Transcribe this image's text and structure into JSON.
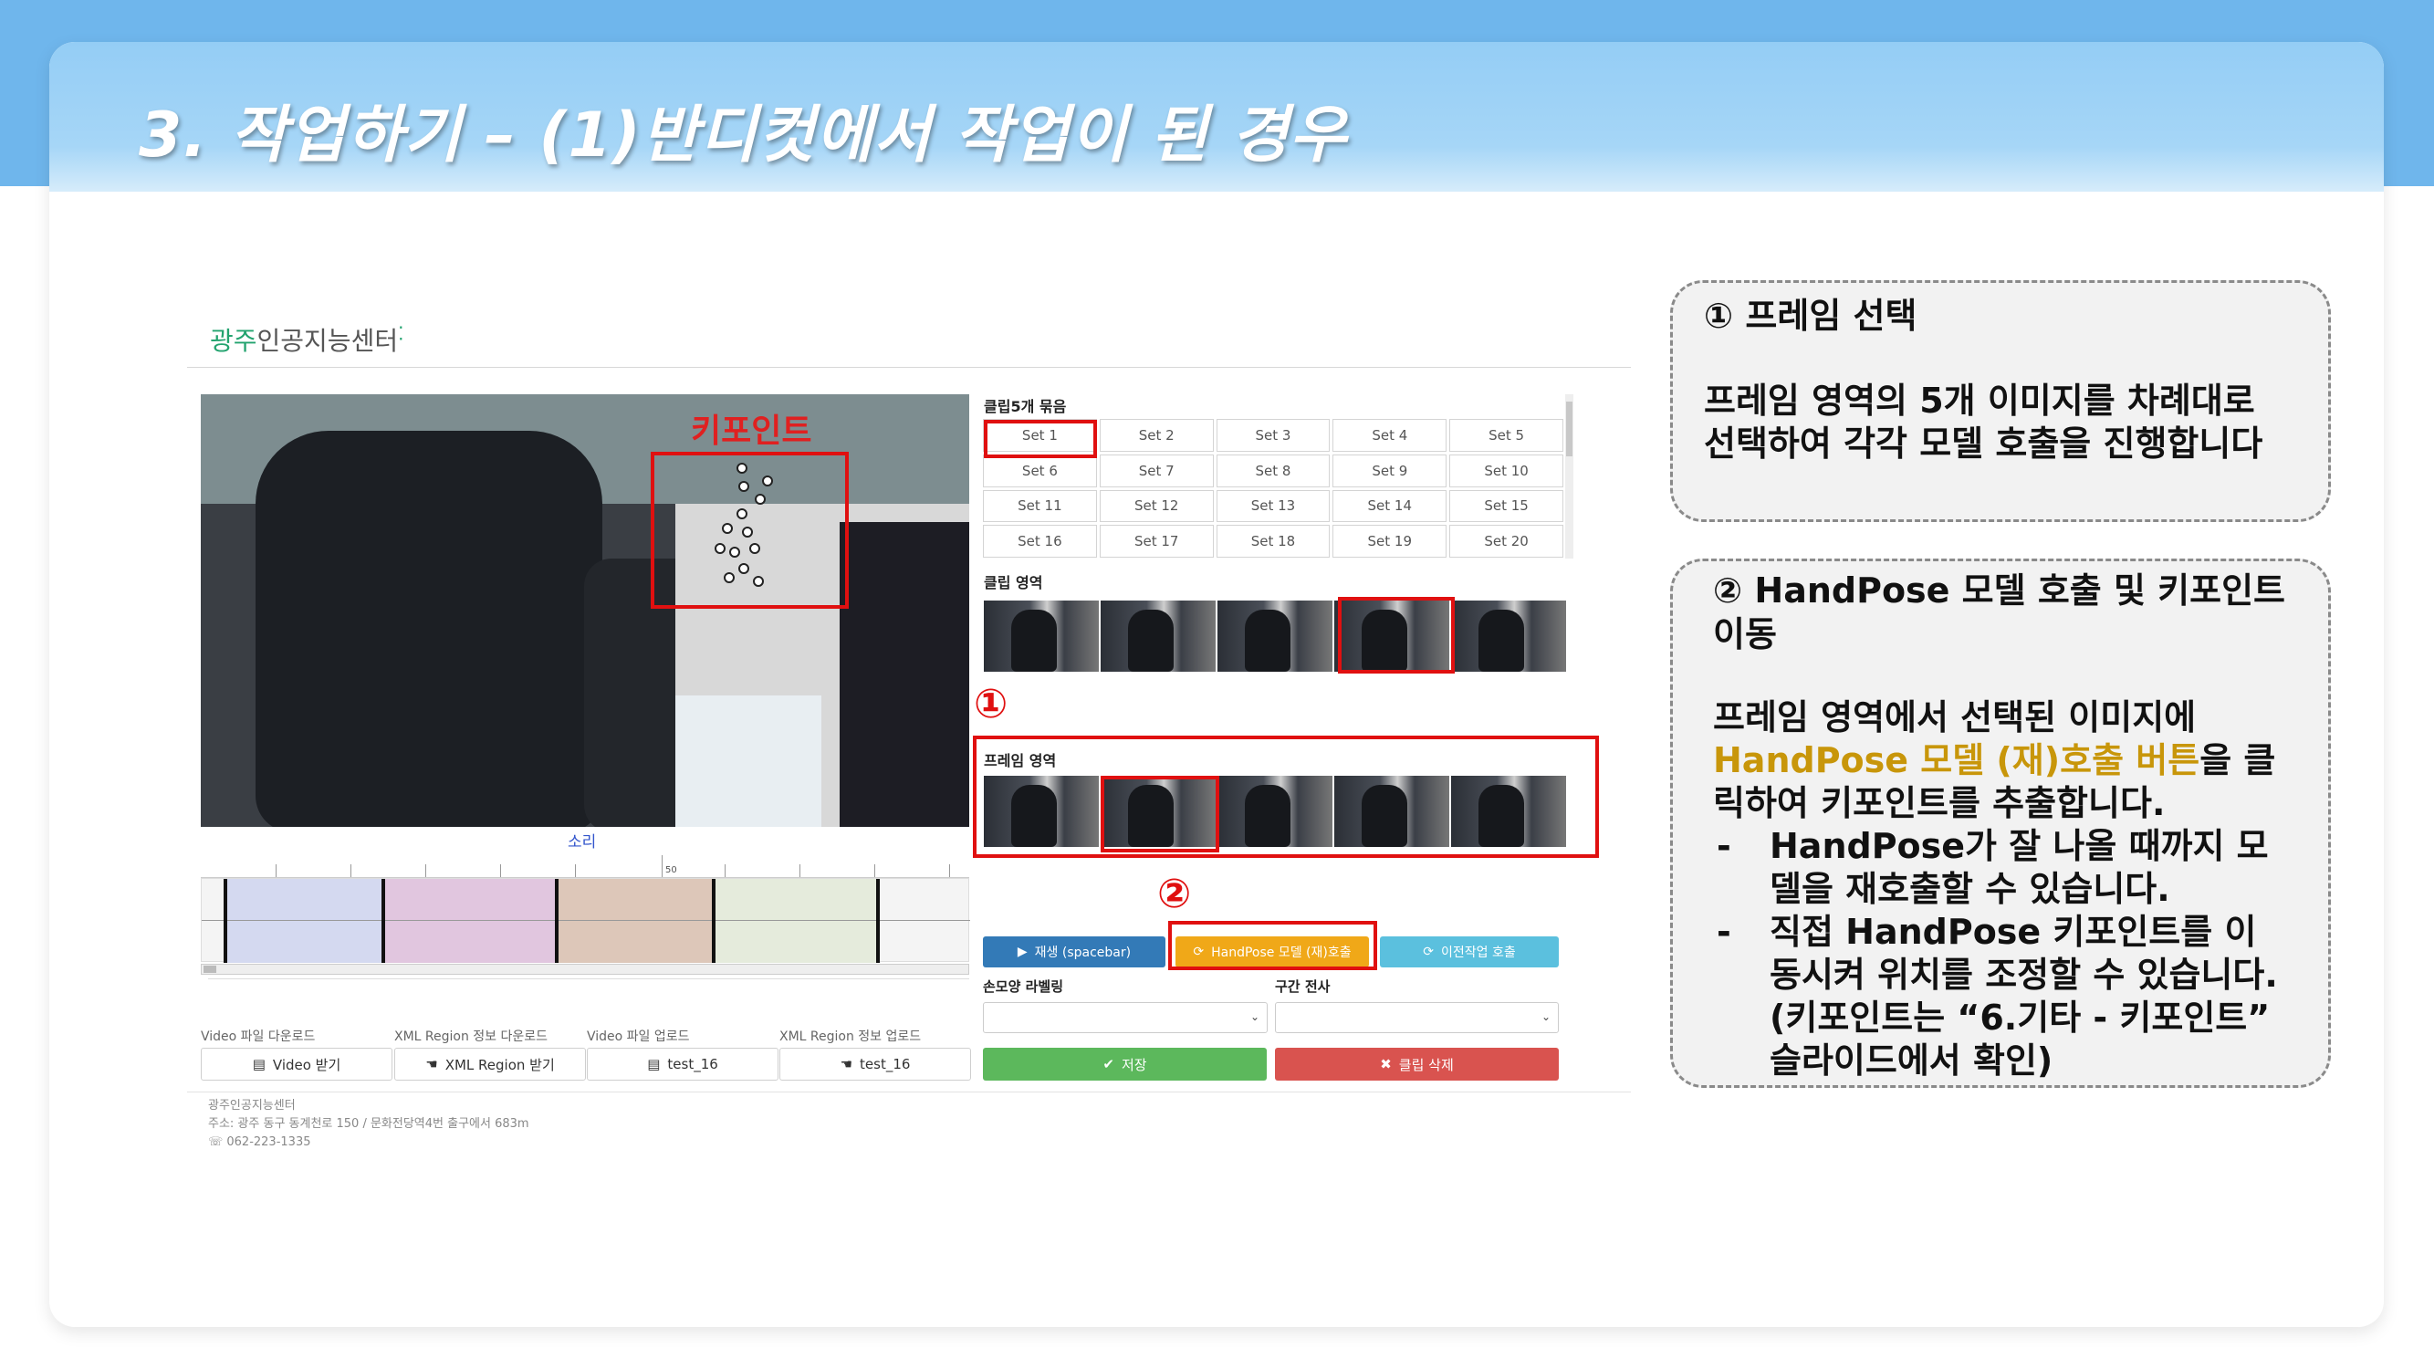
{
  "slide": {
    "title": "3. 작업하기 – (1)반디컷에서 작업이 된 경우"
  },
  "app": {
    "logo_prefix": "광주",
    "logo_suffix": "인공지능센터",
    "keypoint_label": "키포인트",
    "sound_label": "소리",
    "ruler_mark": "50",
    "clip_bundle_title": "클립5개 묶음",
    "sets": [
      "Set 1",
      "Set 2",
      "Set 3",
      "Set 4",
      "Set 5",
      "Set 6",
      "Set 7",
      "Set 8",
      "Set 9",
      "Set 10",
      "Set 11",
      "Set 12",
      "Set 13",
      "Set 14",
      "Set 15",
      "Set 16",
      "Set 17",
      "Set 18",
      "Set 19",
      "Set 20"
    ],
    "selected_set": "Set 1",
    "clip_area_title": "클립 영역",
    "frame_area_title": "프레임 영역",
    "marker_1": "①",
    "marker_2": "②",
    "play_button": "재생 (spacebar)",
    "handpose_button": "HandPose 모델 (재)호출",
    "prev_button": "이전작업 호출",
    "hand_label_title": "손모양 라벨링",
    "section_copy_title": "구간 전사",
    "save_button": "저장",
    "delete_button": "클립 삭제",
    "downloads": [
      {
        "label": "Video 파일 다운로드",
        "button": "Video 받기"
      },
      {
        "label": "XML Region 정보 다운로드",
        "button": "XML Region 받기"
      },
      {
        "label": "Video 파일 업로드",
        "button": "test_16"
      },
      {
        "label": "XML Region 정보 업로드",
        "button": "test_16"
      }
    ],
    "footer": {
      "name": "광주인공지능센터",
      "address": "주소: 광주 동구 동계천로 150 / 문화전당역4번 출구에서 683m",
      "phone": "062-223-1335"
    },
    "colors": {
      "play": "#337ab7",
      "handpose": "#f0a818",
      "prev": "#5bc0de",
      "save": "#5cb85c",
      "delete": "#d9534f",
      "highlight": "#e01010"
    }
  },
  "callouts": {
    "one": {
      "head": "① 프레임 선택",
      "body": "프레임 영역의 5개 이미지를 차례대로 선택하여 각각 모델 호출을 진행합니다"
    },
    "two": {
      "head": "② HandPose 모델 호출 및 키포인트 이동",
      "body_pre": "프레임 영역에서 선택된 이미지에 ",
      "body_hl": "HandPose 모델 (재)호출 버튼",
      "body_post": "을 클릭하여 키포인트를 추출합니다.",
      "bullet_mark": "-",
      "bullets": [
        "HandPose가 잘 나올 때까지 모델을 재호출할 수 있습니다.",
        "직접 HandPose 키포인트를 이동시켜 위치를 조정할 수 있습니다. (키포인트는 “6.기타 - 키포인트” 슬라이드에서 확인)"
      ]
    }
  }
}
